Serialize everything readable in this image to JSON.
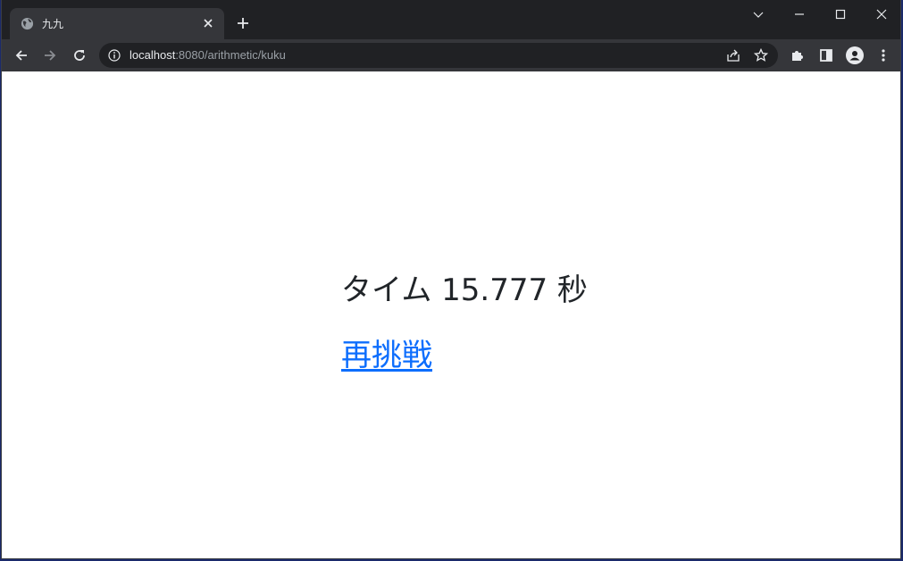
{
  "browser": {
    "tab_title": "九九",
    "url_host": "localhost",
    "url_path": ":8080/arithmetic/kuku"
  },
  "icons": {
    "tab_favicon": "globe-icon",
    "tab_close": "close-icon",
    "new_tab": "plus-icon",
    "tab_search": "chevron-down-icon",
    "minimize": "minimize-icon",
    "maximize": "maximize-icon",
    "close_window": "close-icon",
    "back": "arrow-left-icon",
    "forward": "arrow-right-icon",
    "reload": "reload-icon",
    "site_info": "info-icon",
    "share": "share-icon",
    "bookmark": "star-icon",
    "extensions": "puzzle-icon",
    "side_panel": "side-panel-icon",
    "profile": "profile-icon",
    "menu": "kebab-menu-icon"
  },
  "page": {
    "result_text": "タイム 15.777 秒",
    "retry_label": "再挑戦"
  },
  "colors": {
    "link": "#0d6efd",
    "text": "#212529",
    "chrome_dark": "#202124",
    "chrome_toolbar": "#35363a"
  }
}
